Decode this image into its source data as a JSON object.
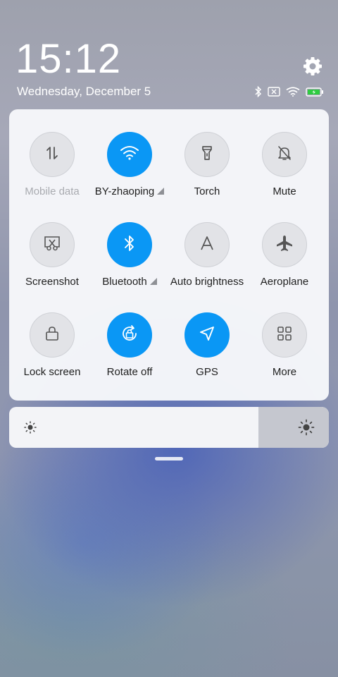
{
  "status": {
    "time": "15:12",
    "date": "Wednesday, December 5",
    "icons": [
      "bluetooth-icon",
      "no-sim-icon",
      "wifi-icon",
      "battery-charging-icon"
    ],
    "battery_color": "#2ecc40"
  },
  "settings_icon": "gear-icon",
  "tiles": [
    {
      "label": "Mobile data",
      "icon": "mobile-data-icon",
      "active": false,
      "disabled": true
    },
    {
      "label": "BY-zhaoping",
      "icon": "wifi-icon",
      "active": true,
      "expandable": true
    },
    {
      "label": "Torch",
      "icon": "torch-icon",
      "active": false
    },
    {
      "label": "Mute",
      "icon": "bell-off-icon",
      "active": false
    },
    {
      "label": "Screenshot",
      "icon": "screenshot-icon",
      "active": false
    },
    {
      "label": "Bluetooth",
      "icon": "bluetooth-icon",
      "active": true,
      "expandable": true
    },
    {
      "label": "Auto brightness",
      "icon": "auto-brightness-icon",
      "active": false
    },
    {
      "label": "Aeroplane",
      "icon": "airplane-icon",
      "active": false
    },
    {
      "label": "Lock screen",
      "icon": "lock-icon",
      "active": false
    },
    {
      "label": "Rotate off",
      "icon": "rotation-lock-icon",
      "active": true
    },
    {
      "label": "GPS",
      "icon": "location-arrow-icon",
      "active": true
    },
    {
      "label": "More",
      "icon": "grid-icon",
      "active": false
    }
  ],
  "brightness": {
    "level": 0.78,
    "min_icon": "sun-small-icon",
    "max_icon": "sun-large-icon"
  },
  "colors": {
    "accent": "#0a97f5",
    "tile_off": "#e2e3e7"
  }
}
